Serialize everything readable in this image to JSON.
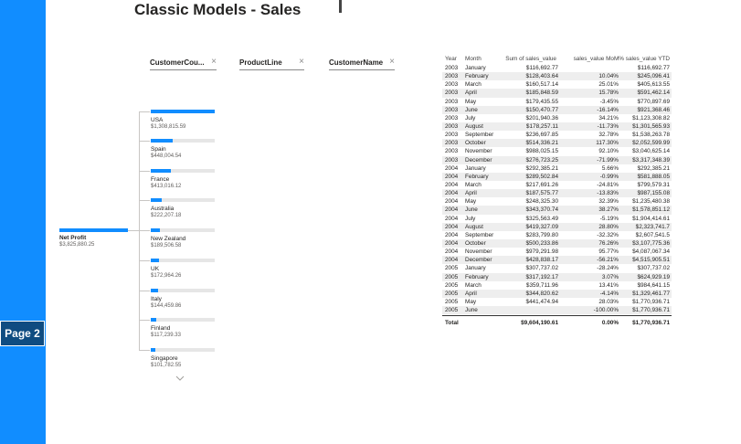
{
  "report": {
    "title": "Classic Models - Sales",
    "page_tab": "Page 2"
  },
  "decomposition_tree": {
    "headers": [
      {
        "label": "CustomerCou...",
        "close": "×"
      },
      {
        "label": "ProductLine",
        "close": "×"
      },
      {
        "label": "CustomerName",
        "close": "×"
      }
    ],
    "root": {
      "label": "Net Profit",
      "value": "$3,825,880.25",
      "fill": 1.0
    },
    "children": [
      {
        "label": "USA",
        "value": "$1,308,815.59",
        "fill": 1.0
      },
      {
        "label": "Spain",
        "value": "$448,004.54",
        "fill": 0.34
      },
      {
        "label": "France",
        "value": "$413,016.12",
        "fill": 0.32
      },
      {
        "label": "Australia",
        "value": "$222,207.18",
        "fill": 0.17
      },
      {
        "label": "New Zealand",
        "value": "$189,506.58",
        "fill": 0.145
      },
      {
        "label": "UK",
        "value": "$172,964.26",
        "fill": 0.13
      },
      {
        "label": "Italy",
        "value": "$144,459.86",
        "fill": 0.11
      },
      {
        "label": "Finland",
        "value": "$117,239.33",
        "fill": 0.09
      },
      {
        "label": "Singapore",
        "value": "$101,782.55",
        "fill": 0.078
      }
    ]
  },
  "matrix": {
    "columns": [
      "Year",
      "Month",
      "Sum of sales_value",
      "sales_value MoM%",
      "sales_value YTD"
    ],
    "rows": [
      [
        "2003",
        "January",
        "$116,692.77",
        "",
        "$116,692.77"
      ],
      [
        "2003",
        "February",
        "$128,403.64",
        "10.04%",
        "$245,096.41"
      ],
      [
        "2003",
        "March",
        "$160,517.14",
        "25.01%",
        "$405,613.55"
      ],
      [
        "2003",
        "April",
        "$185,848.59",
        "15.78%",
        "$591,462.14"
      ],
      [
        "2003",
        "May",
        "$179,435.55",
        "-3.45%",
        "$770,897.69"
      ],
      [
        "2003",
        "June",
        "$150,470.77",
        "-16.14%",
        "$921,368.46"
      ],
      [
        "2003",
        "July",
        "$201,940.36",
        "34.21%",
        "$1,123,308.82"
      ],
      [
        "2003",
        "August",
        "$178,257.11",
        "-11.73%",
        "$1,301,565.93"
      ],
      [
        "2003",
        "September",
        "$236,697.85",
        "32.78%",
        "$1,538,263.78"
      ],
      [
        "2003",
        "October",
        "$514,336.21",
        "117.30%",
        "$2,052,599.99"
      ],
      [
        "2003",
        "November",
        "$988,025.15",
        "92.10%",
        "$3,040,625.14"
      ],
      [
        "2003",
        "December",
        "$276,723.25",
        "-71.99%",
        "$3,317,348.39"
      ],
      [
        "2004",
        "January",
        "$292,385.21",
        "5.66%",
        "$292,385.21"
      ],
      [
        "2004",
        "February",
        "$289,502.84",
        "-0.99%",
        "$581,888.05"
      ],
      [
        "2004",
        "March",
        "$217,691.26",
        "-24.81%",
        "$799,579.31"
      ],
      [
        "2004",
        "April",
        "$187,575.77",
        "-13.83%",
        "$987,155.08"
      ],
      [
        "2004",
        "May",
        "$248,325.30",
        "32.39%",
        "$1,235,480.38"
      ],
      [
        "2004",
        "June",
        "$343,370.74",
        "38.27%",
        "$1,578,851.12"
      ],
      [
        "2004",
        "July",
        "$325,563.49",
        "-5.19%",
        "$1,904,414.61"
      ],
      [
        "2004",
        "August",
        "$419,327.09",
        "28.80%",
        "$2,323,741.7"
      ],
      [
        "2004",
        "September",
        "$283,799.80",
        "-32.32%",
        "$2,607,541.5"
      ],
      [
        "2004",
        "October",
        "$500,233.86",
        "76.26%",
        "$3,107,775.36"
      ],
      [
        "2004",
        "November",
        "$979,291.98",
        "95.77%",
        "$4,087,067.34"
      ],
      [
        "2004",
        "December",
        "$428,838.17",
        "-56.21%",
        "$4,515,905.51"
      ],
      [
        "2005",
        "January",
        "$307,737.02",
        "-28.24%",
        "$307,737.02"
      ],
      [
        "2005",
        "February",
        "$317,192.17",
        "3.07%",
        "$624,929.19"
      ],
      [
        "2005",
        "March",
        "$359,711.96",
        "13.41%",
        "$984,641.15"
      ],
      [
        "2005",
        "April",
        "$344,820.62",
        "-4.14%",
        "$1,329,461.77"
      ],
      [
        "2005",
        "May",
        "$441,474.94",
        "28.03%",
        "$1,770,936.71"
      ],
      [
        "2005",
        "June",
        "",
        "-100.00%",
        "$1,770,936.71"
      ]
    ],
    "total": {
      "label": "Total",
      "sales": "$9,604,190.61",
      "mom": "0.00%",
      "ytd": "$1,770,936.71"
    }
  }
}
